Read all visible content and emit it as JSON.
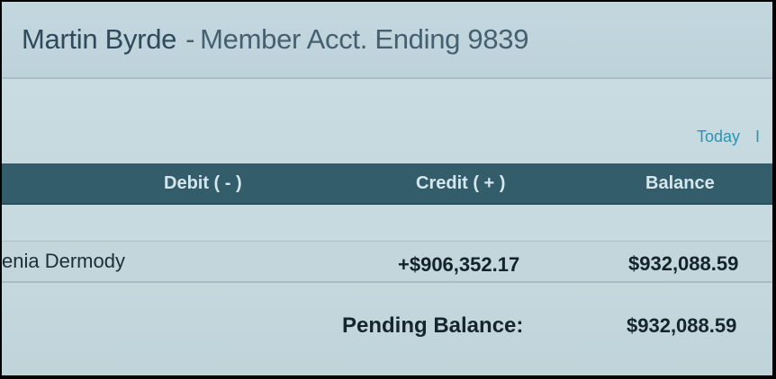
{
  "header": {
    "member_name": "Martin Byrde",
    "separator": "-",
    "account_label": "Member Acct. Ending 9839"
  },
  "filters": {
    "today_label": "Today",
    "divider": "I"
  },
  "table": {
    "columns": {
      "debit": "Debit ( - )",
      "credit": "Credit ( + )",
      "balance": "Balance"
    },
    "rows": [
      {
        "description": "enia Dermody",
        "credit": "+$906,352.17",
        "balance": "$932,088.59"
      }
    ]
  },
  "pending": {
    "label": "Pending Balance:",
    "value": "$932,088.59"
  },
  "colors": {
    "header_bar": "#335d6b",
    "link": "#2b94b0",
    "title_text": "#375262"
  }
}
